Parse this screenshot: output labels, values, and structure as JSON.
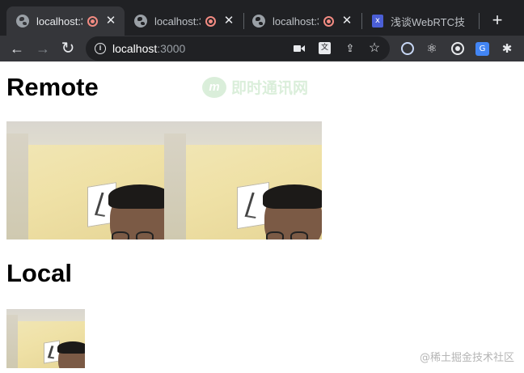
{
  "browser": {
    "tabs": [
      {
        "title": "localhost:3",
        "active": true,
        "recording": true,
        "icon": "globe-icon"
      },
      {
        "title": "localhost:3",
        "active": false,
        "recording": true,
        "icon": "globe-icon"
      },
      {
        "title": "localhost:3",
        "active": false,
        "recording": true,
        "icon": "globe-icon"
      },
      {
        "title": "浅谈WebRTC技",
        "active": false,
        "recording": false,
        "icon": "doc-icon"
      }
    ],
    "close_glyph": "✕",
    "new_tab_glyph": "+",
    "address": {
      "host": "localhost",
      "port": ":3000"
    },
    "nav": {
      "back": "←",
      "forward": "→",
      "reload": "↻"
    },
    "toolbar_icons": [
      "camera-icon",
      "translate-icon",
      "share-icon",
      "star-icon",
      "ring-extension-icon",
      "react-icon",
      "target-icon",
      "google-translate-icon",
      "puzzle-icon"
    ],
    "translate_glyph": "文",
    "gtrans_glyph": "G"
  },
  "page": {
    "remote_heading": "Remote",
    "local_heading": "Local",
    "watermark_logo": "m",
    "watermark_text": "即时通讯网",
    "credit": "@稀土掘金技术社区"
  },
  "colors": {
    "chrome_dark": "#202124",
    "chrome_toolbar": "#35363a",
    "recording": "#f28b82"
  }
}
